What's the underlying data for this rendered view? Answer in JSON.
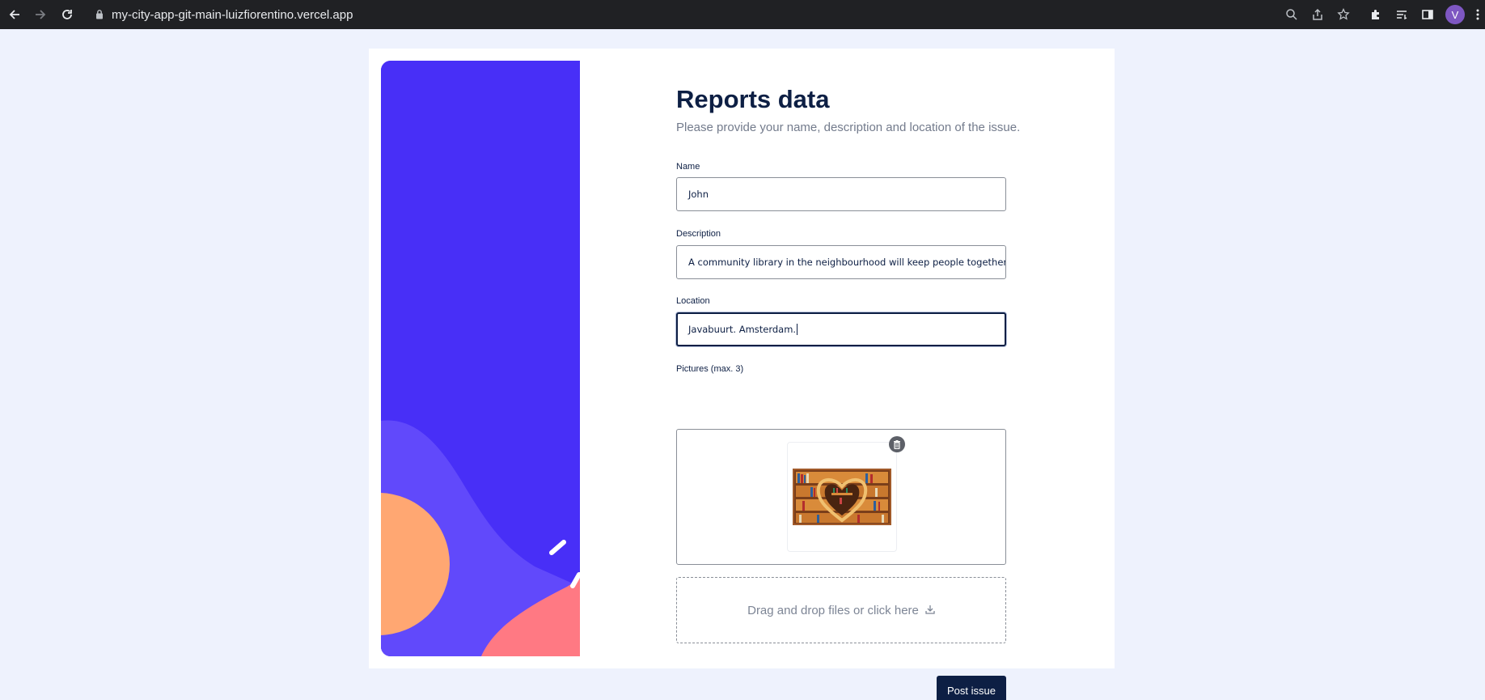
{
  "browser": {
    "url": "my-city-app-git-main-luizfiorentino.vercel.app",
    "profile_initial": "V"
  },
  "form": {
    "title": "Reports data",
    "subtitle": "Please provide your name, description and location of the issue.",
    "name_label": "Name",
    "name_value": "John",
    "description_label": "Description",
    "description_value": "A community library in the neighbourhood will keep people together.",
    "location_label": "Location",
    "location_value": "Javabuurt. Amsterdam.",
    "pictures_label": "Pictures (max. 3)",
    "pictures": [
      {
        "thumbnail": "heart-shaped-bookshelf-image"
      }
    ],
    "dropzone_text": "Drag and drop files or click here",
    "submit_label": "Post issue"
  },
  "colors": {
    "page_background": "#eef2fd",
    "illustration_blue": "#482ff7",
    "illustration_lavender": "#6149fb",
    "illustration_peach": "#ffa772",
    "illustration_pink": "#ff7983",
    "navy": "#0d1f44"
  },
  "icons": {
    "back": "arrow-left-icon",
    "forward": "arrow-right-icon",
    "reload": "reload-icon",
    "lock": "lock-icon",
    "zoom": "zoom-icon",
    "share": "share-icon",
    "bookmark": "star-icon",
    "extensions": "puzzle-icon",
    "reading_list": "reading-list-icon",
    "side_panel": "side-panel-icon",
    "menu": "kebab-menu-icon",
    "delete": "trash-icon",
    "upload": "upload-icon"
  }
}
